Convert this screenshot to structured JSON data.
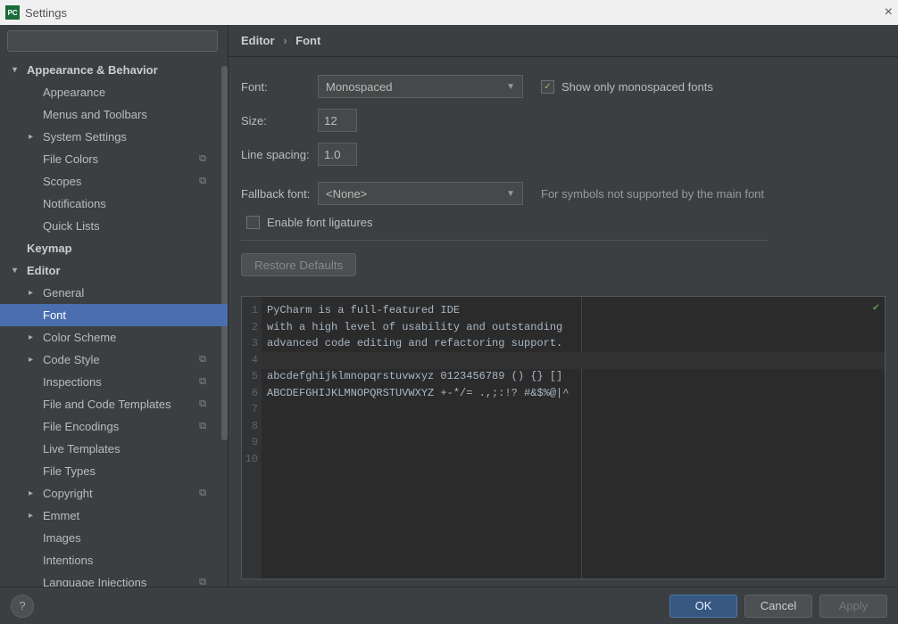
{
  "window": {
    "title": "Settings",
    "logo": "PC"
  },
  "search": {
    "placeholder": ""
  },
  "sidebar": {
    "items": [
      {
        "label": "Appearance & Behavior",
        "level": "l1",
        "arrow": "down"
      },
      {
        "label": "Appearance",
        "level": "l2"
      },
      {
        "label": "Menus and Toolbars",
        "level": "l2"
      },
      {
        "label": "System Settings",
        "level": "l2",
        "arrow": "right"
      },
      {
        "label": "File Colors",
        "level": "l2",
        "copy": true
      },
      {
        "label": "Scopes",
        "level": "l2",
        "copy": true
      },
      {
        "label": "Notifications",
        "level": "l2"
      },
      {
        "label": "Quick Lists",
        "level": "l2"
      },
      {
        "label": "Keymap",
        "level": "l2b"
      },
      {
        "label": "Editor",
        "level": "l1",
        "arrow": "down"
      },
      {
        "label": "General",
        "level": "l2",
        "arrow": "right"
      },
      {
        "label": "Font",
        "level": "l2",
        "selected": true
      },
      {
        "label": "Color Scheme",
        "level": "l2",
        "arrow": "right"
      },
      {
        "label": "Code Style",
        "level": "l2",
        "arrow": "right",
        "copy": true
      },
      {
        "label": "Inspections",
        "level": "l2",
        "copy": true
      },
      {
        "label": "File and Code Templates",
        "level": "l2",
        "copy": true
      },
      {
        "label": "File Encodings",
        "level": "l2",
        "copy": true
      },
      {
        "label": "Live Templates",
        "level": "l2"
      },
      {
        "label": "File Types",
        "level": "l2"
      },
      {
        "label": "Copyright",
        "level": "l2",
        "arrow": "right",
        "copy": true
      },
      {
        "label": "Emmet",
        "level": "l2",
        "arrow": "right"
      },
      {
        "label": "Images",
        "level": "l2"
      },
      {
        "label": "Intentions",
        "level": "l2"
      },
      {
        "label": "Language Injections",
        "level": "l2",
        "copy": true
      }
    ]
  },
  "breadcrumb": {
    "a": "Editor",
    "b": "Font"
  },
  "form": {
    "font_label": "Font:",
    "font_value": "Monospaced",
    "show_mono_label": "Show only monospaced fonts",
    "show_mono_checked": true,
    "size_label": "Size:",
    "size_value": "12",
    "spacing_label": "Line spacing:",
    "spacing_value": "1.0",
    "fallback_label": "Fallback font:",
    "fallback_value": "<None>",
    "fallback_note": "For symbols not supported by the main font",
    "ligatures_label": "Enable font ligatures",
    "restore_label": "Restore Defaults"
  },
  "preview": {
    "lines": [
      "PyCharm is a full-featured IDE",
      "with a high level of usability and outstanding",
      "advanced code editing and refactoring support.",
      "",
      "abcdefghijklmnopqrstuvwxyz 0123456789 () {} []",
      "ABCDEFGHIJKLMNOPQRSTUVWXYZ +-*/= .,;:!? #&$%@|^",
      "",
      "",
      "",
      ""
    ]
  },
  "footer": {
    "help": "?",
    "ok": "OK",
    "cancel": "Cancel",
    "apply": "Apply"
  }
}
